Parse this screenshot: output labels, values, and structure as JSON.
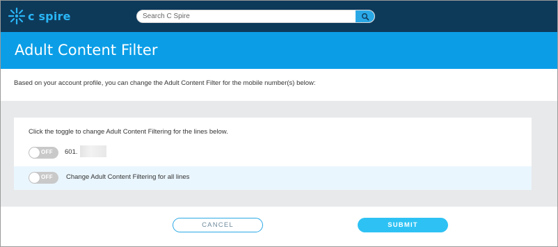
{
  "header": {
    "logo_text": "c spire",
    "search": {
      "placeholder": "Search C Spire",
      "value": ""
    },
    "colors": {
      "nav_bg": "#0e3a5a",
      "accent": "#29b6f6"
    }
  },
  "page": {
    "title": "Adult Content Filter",
    "intro": "Based on your account profile, you can change the Adult Content Filter for the mobile number(s) below:"
  },
  "card": {
    "instruction": "Click the toggle to change Adult Content Filtering for the lines below.",
    "lines": [
      {
        "number": "601.",
        "toggle_state": "OFF"
      }
    ],
    "all_lines": {
      "label": "Change Adult Content Filtering for all lines",
      "toggle_state": "OFF"
    }
  },
  "actions": {
    "cancel_label": "CANCEL",
    "submit_label": "SUBMIT"
  },
  "icons": {
    "logo": "sunburst-logo-icon",
    "search": "search-icon"
  }
}
